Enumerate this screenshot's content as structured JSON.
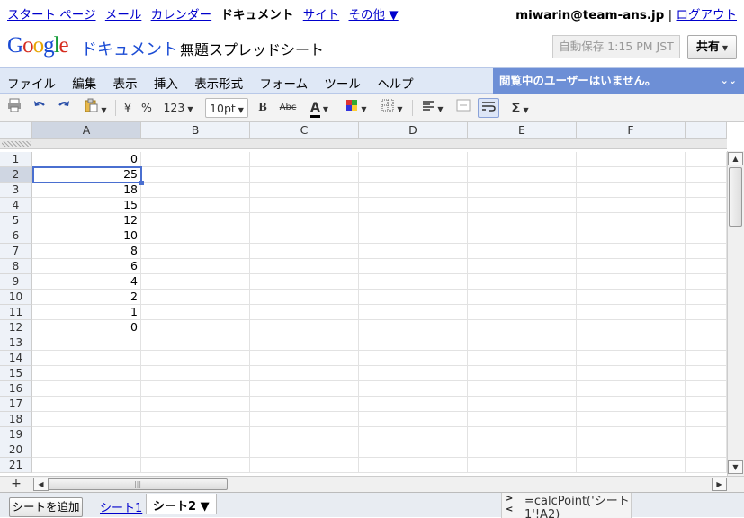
{
  "nav": {
    "links": [
      "スタート ページ",
      "メール",
      "カレンダー"
    ],
    "current": "ドキュメント",
    "links2": [
      "サイト"
    ],
    "more": "その他 ▼",
    "user": "miwarin@team-ans.jp",
    "separator": "|",
    "logout": "ログアウト"
  },
  "header": {
    "logo": "Google",
    "product": "ドキュメント",
    "doc_title": "無題スプレッドシート",
    "autosave": "自動保存 1:15 PM JST",
    "share": "共有"
  },
  "menu": {
    "items": [
      "ファイル",
      "編集",
      "表示",
      "挿入",
      "表示形式",
      "フォーム",
      "ツール",
      "ヘルプ"
    ],
    "viewers": "閲覧中のユーザーはいません。"
  },
  "toolbar": {
    "currency": "¥",
    "percent": "%",
    "number": "123",
    "fontsize": "10pt",
    "bold": "B",
    "strike": "Abc",
    "textcolor": "A",
    "sigma": "Σ"
  },
  "grid": {
    "columns": [
      "A",
      "B",
      "C",
      "D",
      "E",
      "F"
    ],
    "row_numbers": [
      "1",
      "2",
      "3",
      "4",
      "5",
      "6",
      "7",
      "8",
      "9",
      "10",
      "11",
      "12",
      "13",
      "14",
      "15",
      "16",
      "17",
      "18",
      "19",
      "20",
      "21"
    ],
    "col_a_values": [
      "0",
      "25",
      "18",
      "15",
      "12",
      "10",
      "8",
      "6",
      "4",
      "2",
      "1",
      "0"
    ],
    "selected_row": "2",
    "selected_col": "A"
  },
  "bottom": {
    "plus": "+",
    "add_sheet": "シートを追加",
    "tab1": "シート1",
    "tab2": "シート2 ▼",
    "formula_arrows": ">\n<",
    "formula": "=calcPoint('シート1'!A2)"
  },
  "colors": {
    "accent": "#4a6fd0",
    "menubar": "#dfe8f6",
    "viewers_bar": "#6d8fd6"
  }
}
